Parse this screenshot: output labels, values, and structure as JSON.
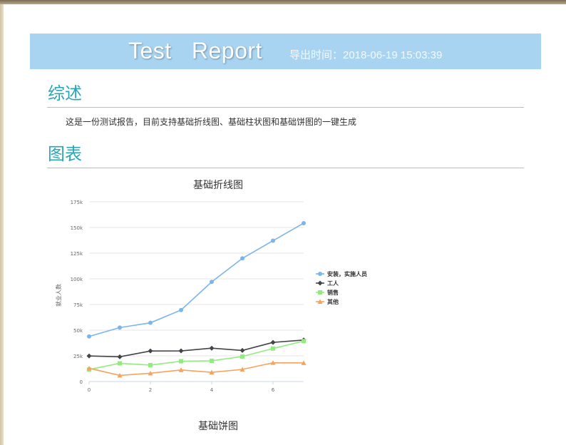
{
  "report": {
    "title": "Test   Report",
    "export_time": "导出时间：2018-06-19 15:03:39"
  },
  "sections": {
    "overview_heading": "综述",
    "overview_text": "这是一份测试报告，目前支持基础折线图、基础柱状图和基础饼图的一键生成",
    "charts_heading": "图表"
  },
  "chart_data": [
    {
      "type": "line",
      "title": "基础折线图",
      "xlabel": "",
      "ylabel": "就业人数",
      "x": [
        0,
        1,
        2,
        3,
        4,
        5,
        6,
        7
      ],
      "xticks": [
        "0",
        "2",
        "4",
        "6"
      ],
      "ylim": [
        0,
        175000
      ],
      "yticks": [
        "0",
        "25k",
        "50k",
        "75k",
        "100k",
        "125k",
        "150k",
        "175k"
      ],
      "grid": true,
      "legend": "right",
      "series": [
        {
          "name": "安装，实施人员",
          "color": "#7cb5ec",
          "marker": "circle",
          "values": [
            43934,
            52503,
            57177,
            69658,
            97031,
            119931,
            137133,
            154175
          ]
        },
        {
          "name": "工人",
          "color": "#434348",
          "marker": "diamond",
          "values": [
            24916,
            24064,
            29742,
            29851,
            32490,
            30282,
            38121,
            40434
          ]
        },
        {
          "name": "销售",
          "color": "#90ed7d",
          "marker": "square",
          "values": [
            11744,
            17722,
            16005,
            19771,
            20185,
            24377,
            32147,
            39387
          ]
        },
        {
          "name": "其他",
          "color": "#f7a35c",
          "marker": "triangle",
          "values": [
            12908,
            5948,
            8105,
            11248,
            8989,
            11816,
            18274,
            18111
          ]
        }
      ]
    },
    {
      "type": "pie",
      "title": "基础饼图"
    }
  ]
}
